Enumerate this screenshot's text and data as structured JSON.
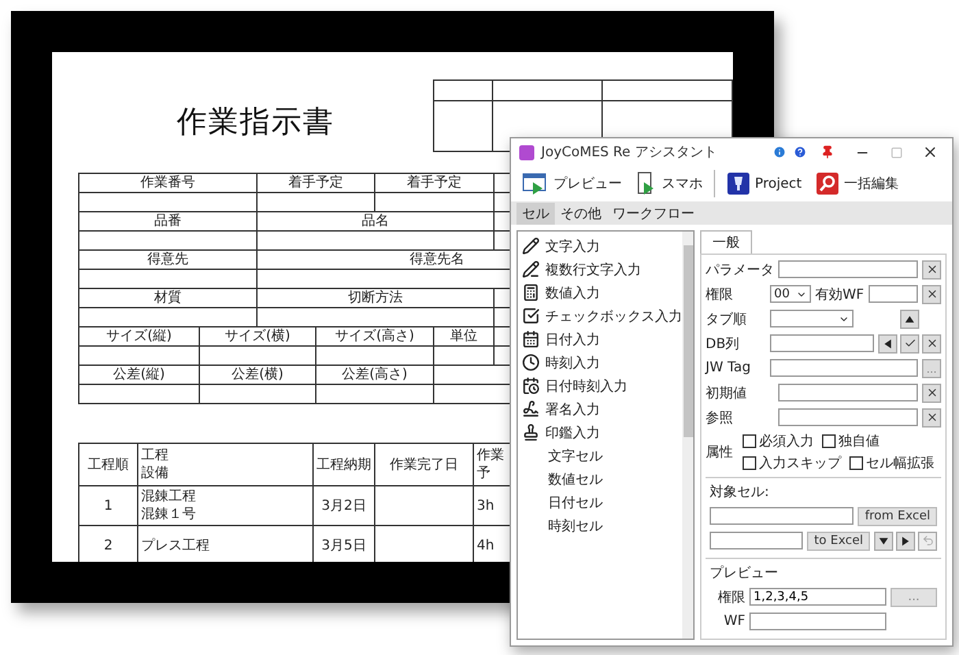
{
  "document": {
    "title": "作業指示書",
    "form_label_rows": [
      [
        "作業番号",
        "着手予定",
        "着手予定"
      ],
      [
        "品番",
        "品名"
      ],
      [
        "得意先",
        "得意先名"
      ],
      [
        "材質",
        "切断方法"
      ],
      [
        "サイズ(縦)",
        "サイズ(横)",
        "サイズ(高さ)",
        "単位"
      ],
      [
        "公差(縦)",
        "公差(横)",
        "公差(高さ)"
      ]
    ],
    "process_table": {
      "columns": [
        {
          "lines": [
            "工程順"
          ]
        },
        {
          "lines": [
            "工程",
            "設備"
          ]
        },
        {
          "lines": [
            "工程納期"
          ]
        },
        {
          "lines": [
            "作業完了日"
          ]
        },
        {
          "lines": [
            "作業",
            "予"
          ]
        }
      ],
      "rows": [
        {
          "no": "1",
          "process": "混錬工程",
          "equipment": "混錬１号",
          "due": "3月2日",
          "hours": "3h"
        },
        {
          "no": "2",
          "process": "プレス工程",
          "due": "3月5日",
          "hours": "4h"
        }
      ]
    }
  },
  "assistant_window": {
    "title": "JoyCoMES Re アシスタント",
    "toolbar": [
      {
        "kind": "preview",
        "label": "プレビュー"
      },
      {
        "kind": "phone",
        "label": "スマホ"
      },
      {
        "kind": "project",
        "label": "Project"
      },
      {
        "kind": "bulk_edit",
        "label": "一括編集"
      }
    ],
    "tabs": [
      {
        "label": "セル",
        "selected": true
      },
      {
        "label": "その他",
        "selected": false
      },
      {
        "label": "ワークフロー",
        "selected": false
      }
    ],
    "palette": [
      {
        "kind": "input",
        "label": "文字入力"
      },
      {
        "kind": "input",
        "label": "複数行文字入力"
      },
      {
        "kind": "input",
        "label": "数値入力"
      },
      {
        "kind": "input",
        "label": "チェックボックス入力"
      },
      {
        "kind": "input",
        "label": "日付入力"
      },
      {
        "kind": "input",
        "label": "時刻入力"
      },
      {
        "kind": "input",
        "label": "日付時刻入力"
      },
      {
        "kind": "input",
        "label": "署名入力"
      },
      {
        "kind": "input",
        "label": "印鑑入力"
      },
      {
        "kind": "cell",
        "label": "文字セル"
      },
      {
        "kind": "cell",
        "label": "数値セル"
      },
      {
        "kind": "cell",
        "label": "日付セル"
      },
      {
        "kind": "cell",
        "label": "時刻セル"
      }
    ],
    "panel_tabs": [
      {
        "label": "一般",
        "selected": true
      }
    ],
    "properties": [
      {
        "kind": "text",
        "label": "パラメータ"
      },
      {
        "kind": "permission",
        "label": "権限",
        "select_value": "00",
        "extra_label": "有効WF"
      },
      {
        "kind": "select",
        "label": "タブ順"
      },
      {
        "kind": "column",
        "label": "DB列"
      },
      {
        "kind": "browse",
        "label": "JW Tag",
        "button": "..."
      },
      {
        "kind": "text",
        "label": "初期値"
      },
      {
        "kind": "text",
        "label": "参照"
      },
      {
        "kind": "checks",
        "label": "属性",
        "options": [
          {
            "label": "必須入力",
            "checked": false
          },
          {
            "label": "独自値",
            "checked": false
          },
          {
            "label": "入力スキップ",
            "checked": false
          },
          {
            "label": "セル幅拡張",
            "checked": false
          }
        ]
      }
    ],
    "target_cells": {
      "title": "対象セル:",
      "rows": [
        {
          "kind": "import",
          "button": "from Excel"
        },
        {
          "kind": "export",
          "button": "to Excel"
        }
      ]
    },
    "preview": {
      "title": "プレビュー",
      "rows": [
        {
          "label": "権限",
          "value": "1,2,3,4,5",
          "button": "..."
        },
        {
          "label": "WF"
        }
      ]
    }
  }
}
